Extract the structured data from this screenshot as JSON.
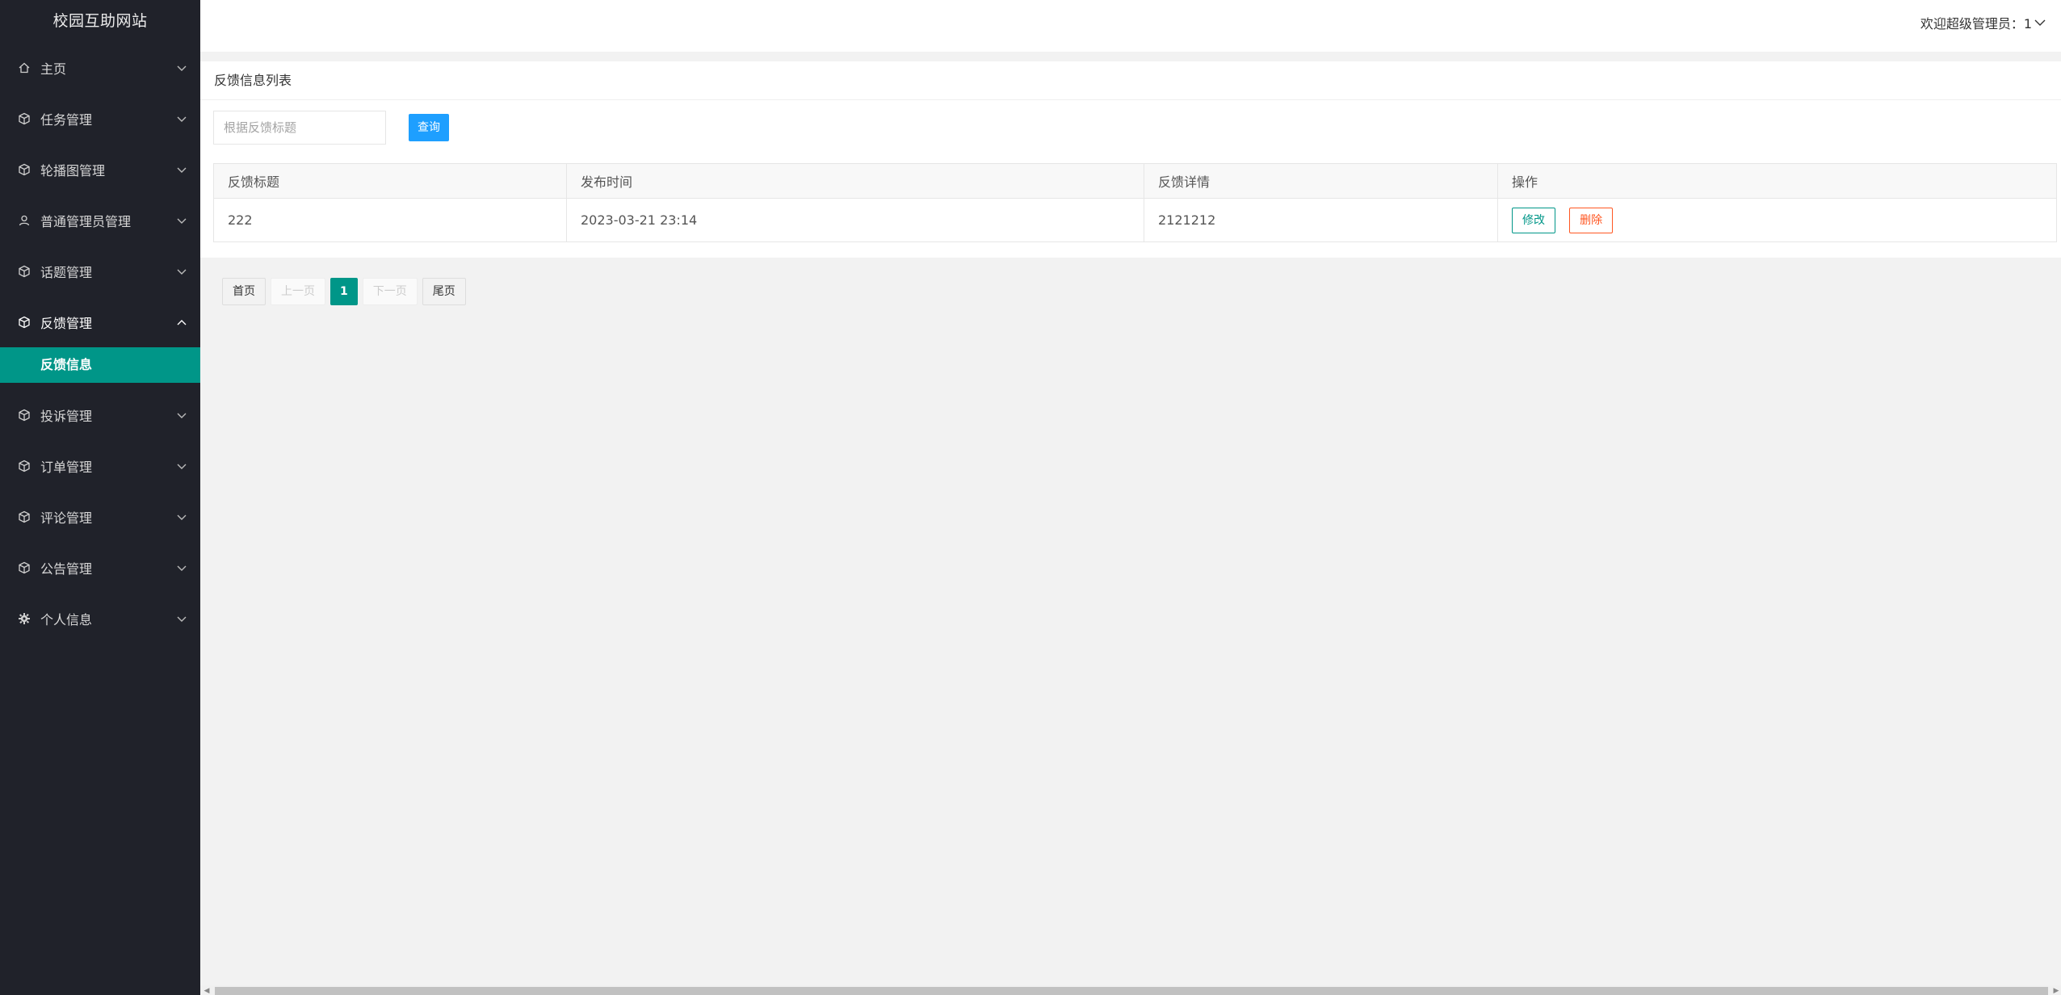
{
  "app": {
    "title": "校园互助网站"
  },
  "header": {
    "welcome": "欢迎超级管理员：1"
  },
  "sidebar": {
    "items": [
      {
        "label": "主页",
        "icon": "home-icon"
      },
      {
        "label": "任务管理",
        "icon": "cube-icon"
      },
      {
        "label": "轮播图管理",
        "icon": "cube-icon"
      },
      {
        "label": "普通管理员管理",
        "icon": "user-icon"
      },
      {
        "label": "话题管理",
        "icon": "cube-icon"
      },
      {
        "label": "反馈管理",
        "icon": "cube-icon",
        "expanded": true,
        "sub": [
          {
            "label": "反馈信息",
            "active": true
          }
        ]
      },
      {
        "label": "投诉管理",
        "icon": "cube-icon"
      },
      {
        "label": "订单管理",
        "icon": "cube-icon"
      },
      {
        "label": "评论管理",
        "icon": "cube-icon"
      },
      {
        "label": "公告管理",
        "icon": "cube-icon"
      },
      {
        "label": "个人信息",
        "icon": "gear-icon"
      }
    ]
  },
  "main": {
    "card_title": "反馈信息列表",
    "search": {
      "placeholder": "根据反馈标题",
      "button": "查询"
    },
    "table": {
      "columns": [
        "反馈标题",
        "发布时间",
        "反馈详情",
        "操作"
      ],
      "rows": [
        {
          "title": "222",
          "time": "2023-03-21 23:14",
          "detail": "2121212",
          "edit": "修改",
          "delete": "删除"
        }
      ]
    },
    "pagination": {
      "first": "首页",
      "prev": "上一页",
      "current": "1",
      "next": "下一页",
      "last": "尾页"
    }
  },
  "colors": {
    "sidebar_bg": "#20222a",
    "accent": "#009688",
    "query_button": "#1e9fff",
    "delete": "#ff5722"
  }
}
